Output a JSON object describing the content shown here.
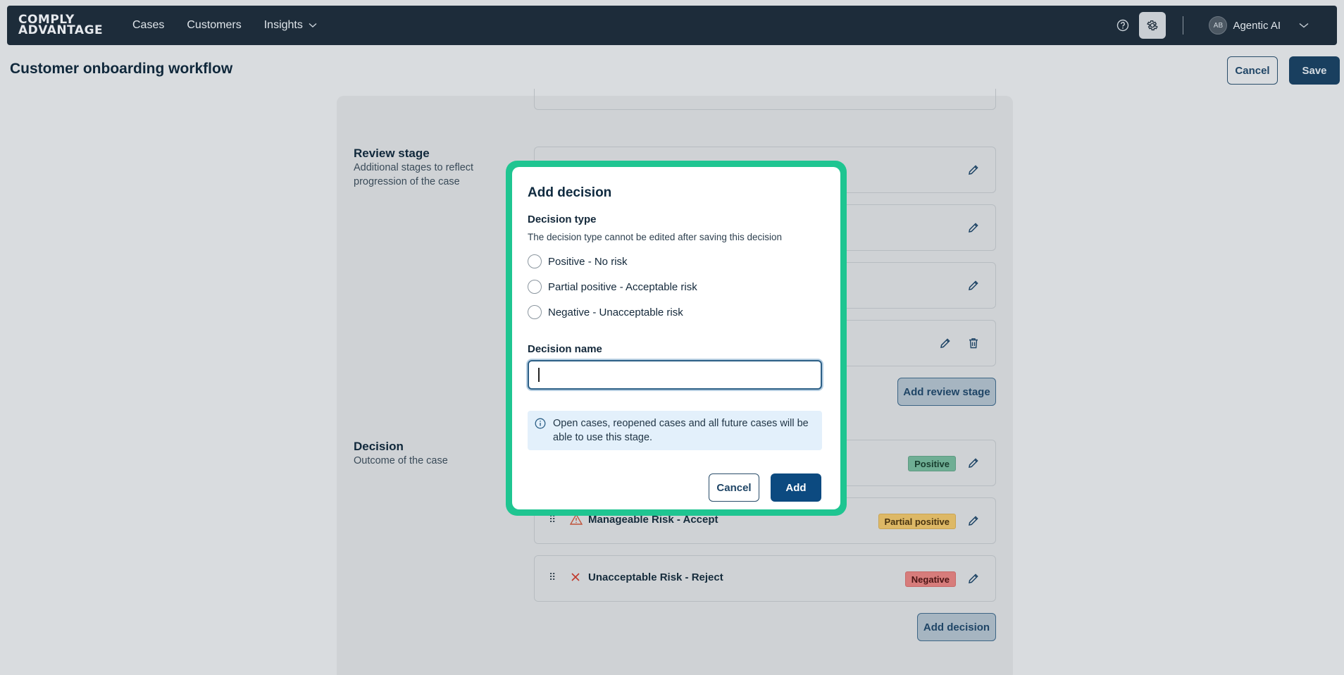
{
  "nav": {
    "logo_line1": "COMPLY",
    "logo_line2": "ADVANTAGE",
    "items": [
      {
        "label": "Cases"
      },
      {
        "label": "Customers"
      },
      {
        "label": "Insights"
      }
    ],
    "user_initials": "AB",
    "user_name": "Agentic AI"
  },
  "page": {
    "title": "Customer onboarding workflow",
    "cancel_label": "Cancel",
    "save_label": "Save"
  },
  "review_stage": {
    "title": "Review stage",
    "description": "Additional stages to reflect progression of the case",
    "add_label": "Add review stage"
  },
  "decision_section": {
    "title": "Decision",
    "description": "Outcome of the case",
    "add_label": "Add decision",
    "rows": [
      {
        "label": "",
        "badge": "Positive",
        "color": "#6fae94"
      },
      {
        "label": "Manageable Risk - Accept",
        "badge": "Partial positive",
        "color": "#ddb866"
      },
      {
        "label": "Unacceptable Risk - Reject",
        "badge": "Negative",
        "color": "#d77c7b"
      }
    ]
  },
  "modal": {
    "title": "Add decision",
    "type_label": "Decision type",
    "type_hint": "The decision type cannot be edited after saving this decision",
    "options": [
      {
        "label": "Positive - No risk"
      },
      {
        "label": "Partial positive - Acceptable risk"
      },
      {
        "label": "Negative - Unacceptable risk"
      }
    ],
    "name_label": "Decision name",
    "name_value": "",
    "info_text": "Open cases, reopened cases and all future cases will be able to use this stage.",
    "cancel_label": "Cancel",
    "add_label": "Add"
  },
  "colors": {
    "accent": "#1fc591",
    "primary": "#0c4a80",
    "nav_bg": "#1d2c3a"
  }
}
